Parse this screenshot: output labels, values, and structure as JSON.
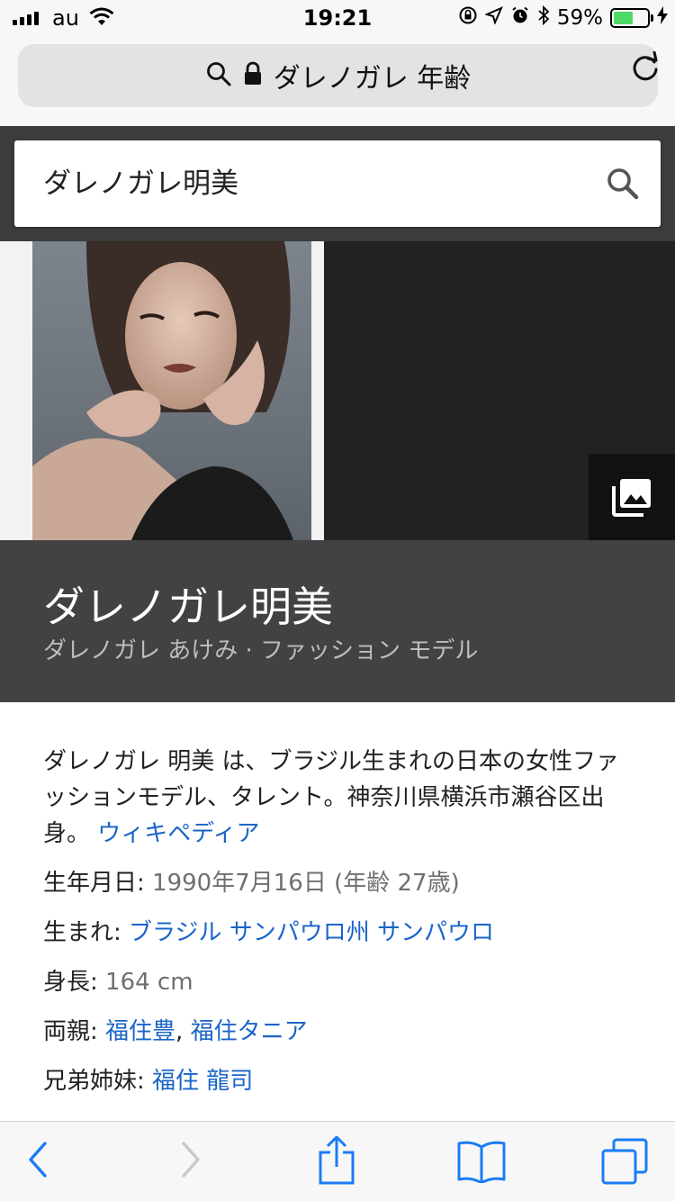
{
  "status_bar": {
    "carrier": "au",
    "time": "19:21",
    "battery": "59%",
    "battery_level": 0.59,
    "battery_color": "#4cd964"
  },
  "address_bar": {
    "text": "ダレノガレ 年齢",
    "icons": [
      "search-icon",
      "lock-icon",
      "reload-icon"
    ]
  },
  "search": {
    "value": "ダレノガレ明美",
    "icon": "search-icon"
  },
  "knowledge_panel": {
    "title": "ダレノガレ明美",
    "subtitle": "ダレノガレ あけみ · ファッション モデル",
    "description": "ダレノガレ 明美 は、ブラジル生まれの日本の女性ファッションモデル、タレント。神奈川県横浜市瀬谷区出身。",
    "source_link": "ウィキペディア",
    "facts": {
      "birth_label": "生年月日:",
      "birth_value": "1990年7月16日 (年齢 27歳)",
      "born_label": "生まれ:",
      "born_value": "ブラジル サンパウロ州 サンパウロ",
      "height_label": "身長:",
      "height_value": "164 cm",
      "parents_label": "両親:",
      "parent_1": "福住豊",
      "parents_sep": ",",
      "parent_2": "福住タニア",
      "siblings_label": "兄弟姉妹:",
      "siblings_value": "福住 龍司"
    },
    "link_color": "#1a64c8"
  },
  "toolbar": {
    "icons": [
      "back-icon",
      "forward-icon",
      "share-icon",
      "bookmarks-icon",
      "tabs-icon"
    ],
    "accent": "#1a7cf5"
  }
}
